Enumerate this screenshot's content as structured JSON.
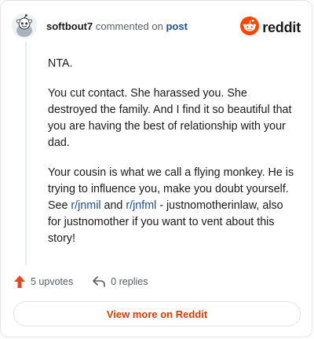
{
  "header": {
    "username": "softbout7",
    "commented_on": "commented on",
    "post_link": "post",
    "brand": "reddit"
  },
  "comment": {
    "p1": "NTA.",
    "p2": "You cut contact. She harassed you. She destroyed the family. And I find it so beautiful that you are having the best of relationship with your dad.",
    "p3_text1": "Your cousin is what we call a flying monkey. He is trying to influence you, make you doubt yourself. See ",
    "p3_link1": "r/jnmil",
    "p3_and": " and ",
    "p3_link2": "r/jnfml",
    "p3_text2": " - justnomotherinlaw, also for justnomother if you want to vent about this story!"
  },
  "actions": {
    "upvotes": "5 upvotes",
    "replies": "0 replies"
  },
  "cta": {
    "label": "View more on Reddit"
  },
  "colors": {
    "brand": "#ff4500",
    "link": "#1d4f91",
    "cta_text": "#d93a00",
    "upvote": "#e8461e"
  },
  "icons": {
    "avatar": "snoo-avatar-icon",
    "brand": "reddit-logo-icon",
    "upvote": "upvote-arrow-icon",
    "reply": "reply-arrow-icon"
  }
}
